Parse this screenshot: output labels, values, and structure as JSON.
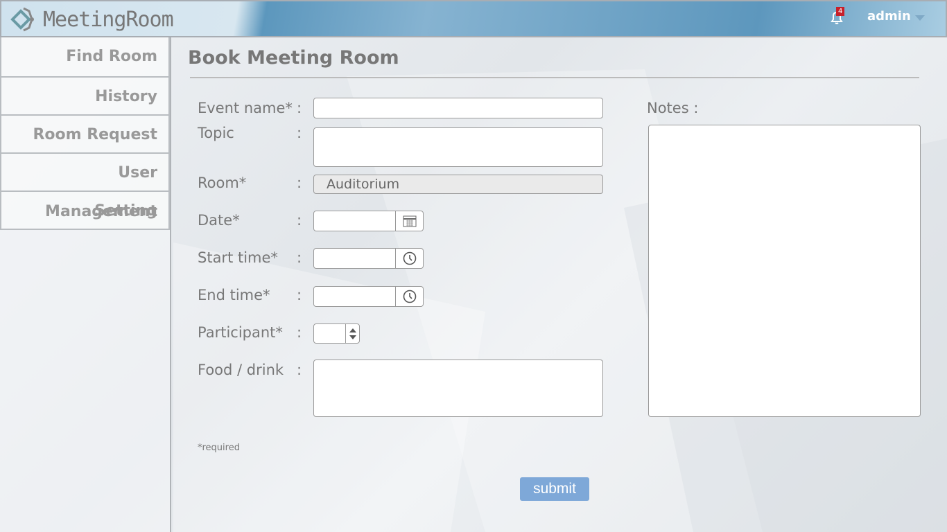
{
  "app": {
    "name": "MeetingRoom"
  },
  "header": {
    "notifications": "4",
    "user": "admin"
  },
  "sidebar": {
    "items": [
      {
        "label": "Find Room"
      },
      {
        "label": "History"
      },
      {
        "label": "Room Request"
      },
      {
        "label": "User Management"
      },
      {
        "label": "Setting"
      }
    ]
  },
  "page": {
    "title": "Book Meeting Room"
  },
  "form": {
    "event_name": "Event name*",
    "topic": "Topic",
    "room": "Room*",
    "room_value": "Auditorium",
    "date": "Date*",
    "start_time": "Start time*",
    "end_time": "End time*",
    "participant": "Participant*",
    "food": "Food / drink",
    "notes": "Notes :",
    "colon": ":",
    "required_note": "*required",
    "submit": "submit"
  }
}
